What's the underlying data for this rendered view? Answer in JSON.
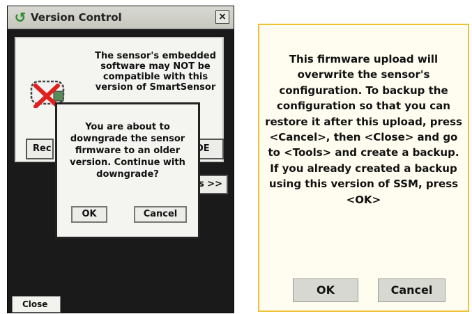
{
  "version_control": {
    "title": "Version Control",
    "close_glyph": "×",
    "message": "The sensor's embedded software may NOT be compatible with this version of SmartSensor",
    "button_left_partial": "Rec",
    "button_right_partial": "DE",
    "button_s_partial": "s >>",
    "close_button": "Close"
  },
  "downgrade_dialog": {
    "message": "You are about to downgrade the sensor firmware to an older version. Continue with downgrade?",
    "ok": "OK",
    "cancel": "Cancel"
  },
  "firmware_dialog": {
    "message": "This firmware upload will overwrite the sensor's configuration. To backup the configuration so that you can restore it after this upload, press <Cancel>, then <Close> and go to <Tools> and create a backup. If you already created a backup using this version of SSM, press <OK>",
    "ok": "OK",
    "cancel": "Cancel",
    "border_color": "#f0c233"
  },
  "icons": {
    "app": "app-logo-icon",
    "sensor": "sensor-device-icon",
    "error": "red-x-icon"
  }
}
